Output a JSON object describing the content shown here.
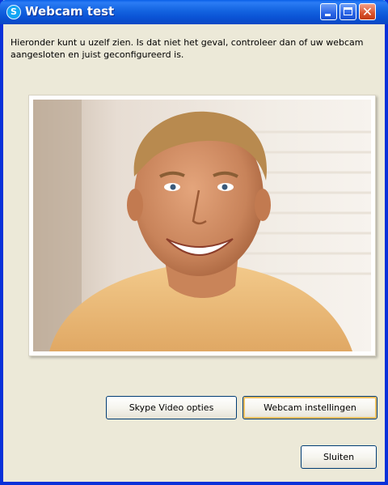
{
  "window": {
    "title": "Webcam test",
    "app_icon_glyph": "S",
    "app_icon_name": "skype-icon",
    "controls": {
      "minimize_icon": "minimize-icon",
      "maximize_icon": "maximize-icon",
      "close_icon": "close-icon",
      "close_glyph": "✕"
    },
    "colors": {
      "titlebar": "#0b54d6",
      "frame": "#0831d9",
      "background": "#ece9d8",
      "close_button": "#d9532c"
    }
  },
  "content": {
    "intro_text": "Hieronder kunt u uzelf zien. Is dat niet het geval, controleer dan of uw webcam aangesloten en juist geconfigureerd is."
  },
  "buttons": {
    "video_options_label": "Skype Video opties",
    "webcam_settings_label": "Webcam instellingen",
    "close_label": "Sluiten"
  }
}
